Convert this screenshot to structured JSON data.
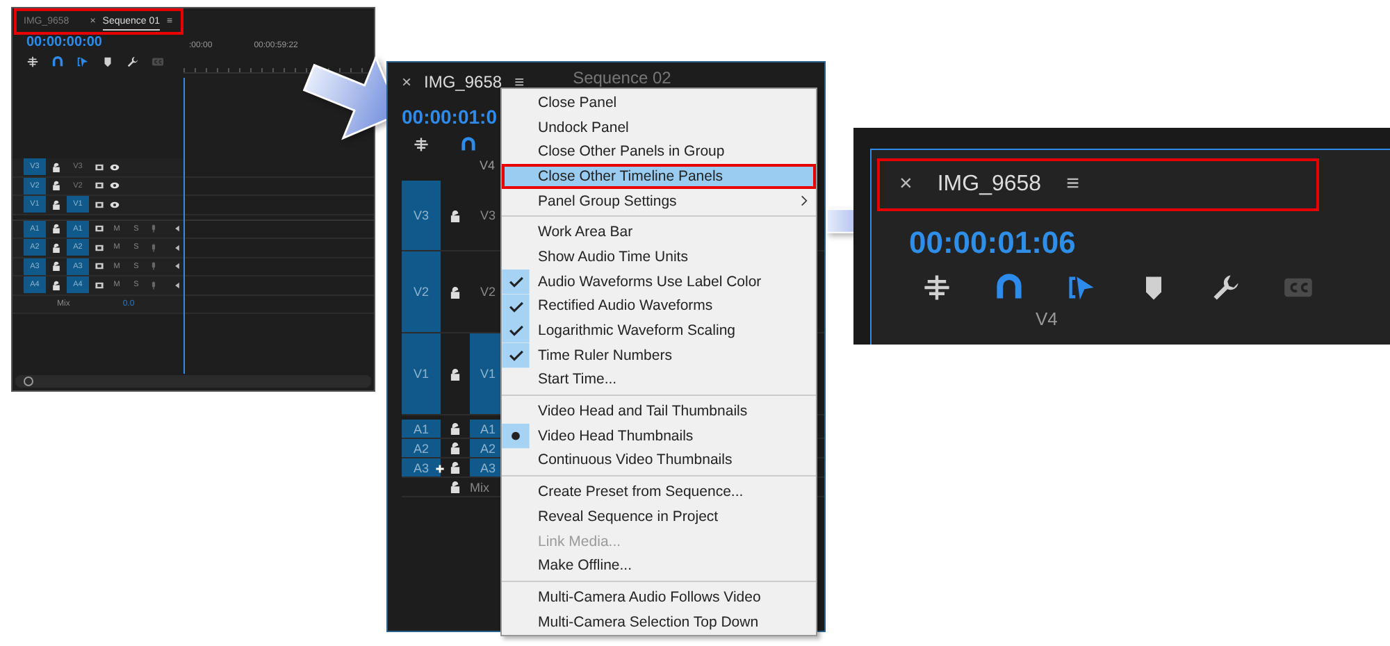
{
  "first_timeline": {
    "marked": true,
    "close_glyph": "×",
    "menu_glyph": "≡",
    "tabs": [
      {
        "label": "IMG_9658",
        "selected": false
      },
      {
        "label": "Sequence 01",
        "selected": true
      }
    ],
    "timecode": "00:00:00:00",
    "toolbar": [
      {
        "kind": "nest",
        "on": false
      },
      {
        "kind": "snap",
        "on": true
      },
      {
        "kind": "linked",
        "on": true
      },
      {
        "kind": "marker",
        "on": false
      },
      {
        "kind": "wrench",
        "on": false
      },
      {
        "kind": "captions",
        "on": false
      }
    ],
    "ruler": [
      ":00:00",
      "00:00:59:22"
    ],
    "tracks": [
      {
        "kind": "video",
        "patch": "V3",
        "label": "V3",
        "targeted": false
      },
      {
        "kind": "video",
        "patch": "V2",
        "label": "V2",
        "targeted": false
      },
      {
        "kind": "video",
        "patch": "V1",
        "label": "V1",
        "targeted": true
      },
      {
        "kind": "audio",
        "patch": "A1",
        "label": "A1",
        "targeted": true,
        "mute": "M",
        "solo": "S"
      },
      {
        "kind": "audio",
        "patch": "A2",
        "label": "A2",
        "targeted": true,
        "mute": "M",
        "solo": "S"
      },
      {
        "kind": "audio",
        "patch": "A3",
        "label": "A3",
        "targeted": true,
        "mute": "M",
        "solo": "S"
      },
      {
        "kind": "audio",
        "patch": "A4",
        "label": "A4",
        "targeted": true,
        "mute": "M",
        "solo": "S"
      }
    ],
    "mix": {
      "label": "Mix",
      "value": "0.0"
    }
  },
  "second_timeline": {
    "close_glyph": "×",
    "menu_glyph": "≡",
    "tabs": [
      {
        "label": "IMG_9658",
        "selected": true
      },
      {
        "label": "Sequence 02",
        "selected": false
      }
    ],
    "timecode": "00:00:01:0",
    "toolbar": [
      {
        "kind": "nest",
        "on": false
      },
      {
        "kind": "snap",
        "on": true
      }
    ],
    "track_label": "V4",
    "tracks": [
      {
        "kind": "video",
        "patch": "V3",
        "label": "V3",
        "targeted": false
      },
      {
        "kind": "video",
        "patch": "V2",
        "label": "V2",
        "targeted": false
      },
      {
        "kind": "video",
        "patch": "V1",
        "label": "V1",
        "targeted": true
      },
      {
        "kind": "audio",
        "patch": "A1",
        "label": "A1",
        "targeted": true
      },
      {
        "kind": "audio",
        "patch": "A2",
        "label": "A2",
        "targeted": true
      },
      {
        "kind": "audio",
        "patch": "A3",
        "label": "A3",
        "targeted": true
      }
    ],
    "mix": {
      "label": "Mix"
    },
    "menu": [
      [
        {
          "kind": "action",
          "label": "Close Panel",
          "highlighted": false,
          "disabled": false,
          "marked": false
        },
        {
          "kind": "action",
          "label": "Undock Panel",
          "highlighted": false,
          "disabled": false,
          "marked": false
        },
        {
          "kind": "action",
          "label": "Close Other Panels in Group",
          "highlighted": false,
          "disabled": false,
          "marked": false
        },
        {
          "kind": "action",
          "label": "Close Other Timeline Panels",
          "highlighted": true,
          "disabled": false,
          "marked": true
        },
        {
          "kind": "submenu",
          "label": "Panel Group Settings",
          "highlighted": false,
          "disabled": false,
          "marked": false
        }
      ],
      [
        {
          "kind": "check",
          "label": "Work Area Bar",
          "checked": false,
          "highlighted": false,
          "disabled": false,
          "marked": false
        },
        {
          "kind": "check",
          "label": "Show Audio Time Units",
          "checked": false,
          "highlighted": false,
          "disabled": false,
          "marked": false
        },
        {
          "kind": "check",
          "label": "Audio Waveforms Use Label Color",
          "checked": true,
          "highlighted": false,
          "disabled": false,
          "marked": false
        },
        {
          "kind": "check",
          "label": "Rectified Audio Waveforms",
          "checked": true,
          "highlighted": false,
          "disabled": false,
          "marked": false
        },
        {
          "kind": "check",
          "label": "Logarithmic Waveform Scaling",
          "checked": true,
          "highlighted": false,
          "disabled": false,
          "marked": false
        },
        {
          "kind": "check",
          "label": "Time Ruler Numbers",
          "checked": true,
          "highlighted": false,
          "disabled": false,
          "marked": false
        },
        {
          "kind": "action",
          "label": "Start Time...",
          "highlighted": false,
          "disabled": false,
          "marked": false
        }
      ],
      [
        {
          "kind": "radio",
          "label": "Video Head and Tail Thumbnails",
          "selected": false,
          "highlighted": false,
          "disabled": false,
          "marked": false
        },
        {
          "kind": "radio",
          "label": "Video Head Thumbnails",
          "selected": true,
          "highlighted": false,
          "disabled": false,
          "marked": false
        },
        {
          "kind": "radio",
          "label": "Continuous Video Thumbnails",
          "selected": false,
          "highlighted": false,
          "disabled": false,
          "marked": false
        }
      ],
      [
        {
          "kind": "action",
          "label": "Create Preset from Sequence...",
          "highlighted": false,
          "disabled": false,
          "marked": false
        },
        {
          "kind": "action",
          "label": "Reveal Sequence in Project",
          "highlighted": false,
          "disabled": false,
          "marked": false
        },
        {
          "kind": "action",
          "label": "Link Media...",
          "highlighted": false,
          "disabled": true,
          "marked": false
        },
        {
          "kind": "action",
          "label": "Make Offline...",
          "highlighted": false,
          "disabled": false,
          "marked": false
        }
      ],
      [
        {
          "kind": "action",
          "label": "Multi-Camera Audio Follows Video",
          "highlighted": false,
          "disabled": false,
          "marked": false
        },
        {
          "kind": "action",
          "label": "Multi-Camera Selection Top Down",
          "highlighted": false,
          "disabled": false,
          "marked": false
        }
      ]
    ]
  },
  "third_timeline": {
    "marked": true,
    "close_glyph": "×",
    "menu_glyph": "≡",
    "tabs": [
      {
        "label": "IMG_9658",
        "selected": true
      }
    ],
    "timecode": "00:00:01:06",
    "toolbar": [
      {
        "kind": "nest",
        "on": false
      },
      {
        "kind": "snap",
        "on": true
      },
      {
        "kind": "linked",
        "on": true
      },
      {
        "kind": "marker",
        "on": false
      },
      {
        "kind": "wrench",
        "on": false
      },
      {
        "kind": "captions",
        "on": false
      }
    ],
    "track_label": "V4"
  }
}
